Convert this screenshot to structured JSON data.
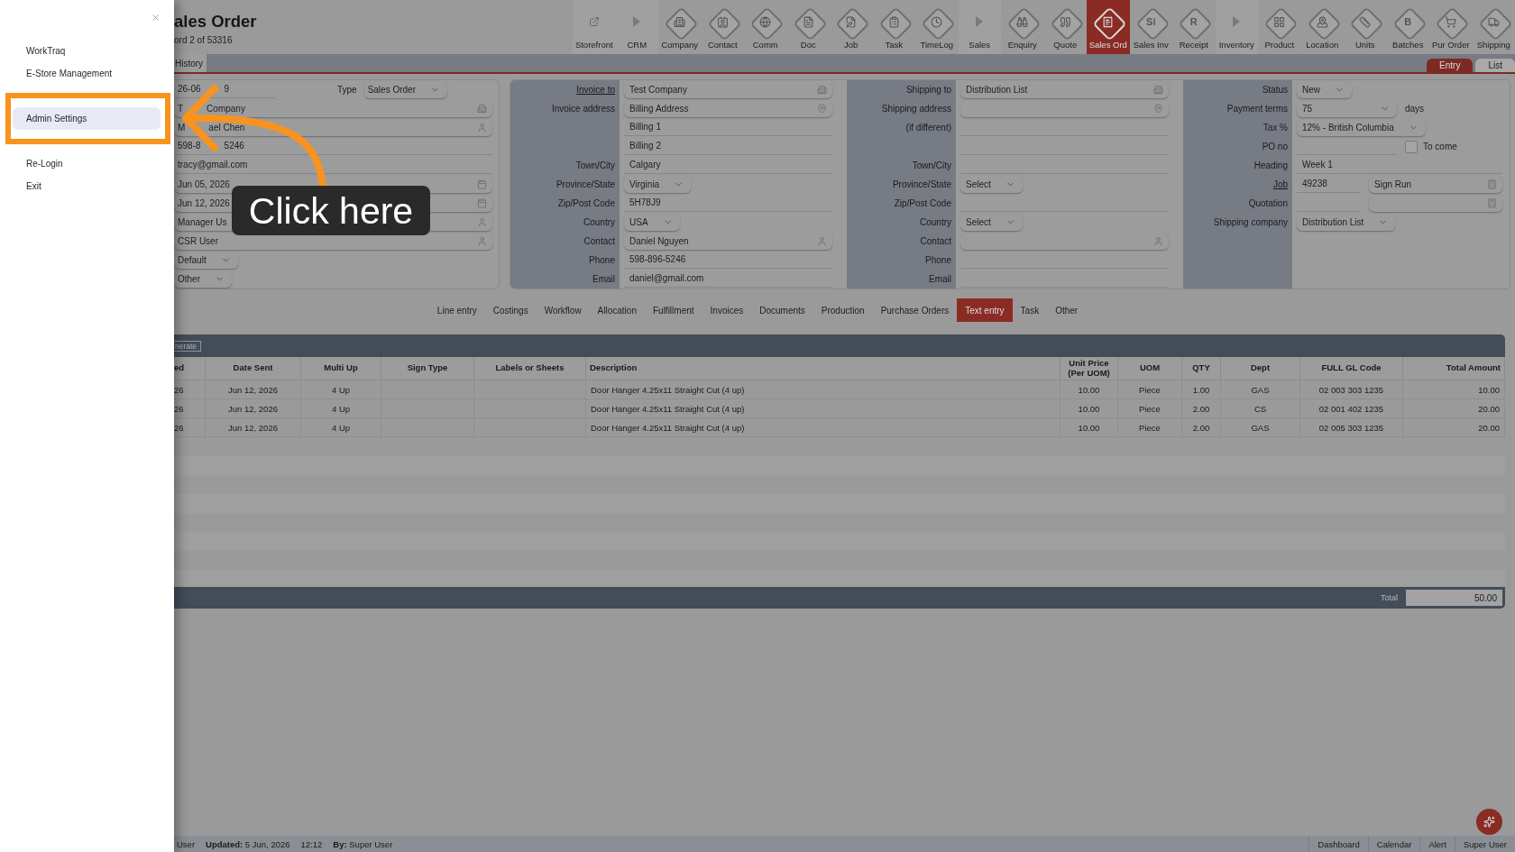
{
  "sidebar": {
    "items": [
      {
        "label": "WorkTraq",
        "selected": false
      },
      {
        "label": "E-Store Management",
        "selected": false
      },
      {
        "label": "Admin Settings",
        "selected": true
      },
      {
        "label": "Re-Login",
        "selected": false
      },
      {
        "label": "Exit",
        "selected": false
      }
    ]
  },
  "tutorial": {
    "callout": "Click here"
  },
  "header": {
    "title": "ales Order",
    "record": "ord 2 of 53316"
  },
  "toolbar": [
    {
      "label": "Storefront",
      "kind": "link",
      "selected": false
    },
    {
      "label": "CRM",
      "kind": "section",
      "selected": false
    },
    {
      "label": "Company",
      "kind": "module",
      "selected": false
    },
    {
      "label": "Contact",
      "kind": "module",
      "selected": false
    },
    {
      "label": "Comm",
      "kind": "module",
      "selected": false
    },
    {
      "label": "Doc",
      "kind": "module",
      "selected": false
    },
    {
      "label": "Job",
      "kind": "module",
      "selected": false
    },
    {
      "label": "Task",
      "kind": "module",
      "selected": false
    },
    {
      "label": "TimeLog",
      "kind": "module",
      "selected": false
    },
    {
      "label": "Sales",
      "kind": "section",
      "selected": false
    },
    {
      "label": "Enquiry",
      "kind": "module",
      "selected": false
    },
    {
      "label": "Quote",
      "kind": "module",
      "selected": false
    },
    {
      "label": "Sales Ord",
      "kind": "module",
      "selected": true
    },
    {
      "label": "Sales Inv",
      "kind": "module",
      "glyph": "Si",
      "selected": false
    },
    {
      "label": "Receipt",
      "kind": "module",
      "glyph": "R",
      "selected": false
    },
    {
      "label": "Inventory",
      "kind": "section",
      "selected": false
    },
    {
      "label": "Product",
      "kind": "module",
      "selected": false
    },
    {
      "label": "Location",
      "kind": "module",
      "selected": false
    },
    {
      "label": "Units",
      "kind": "module",
      "selected": false
    },
    {
      "label": "Batches",
      "kind": "module",
      "glyph": "B",
      "selected": false
    },
    {
      "label": "Pur Order",
      "kind": "module",
      "selected": false
    },
    {
      "label": "Shipping",
      "kind": "module",
      "selected": false
    }
  ],
  "history_tab": {
    "label": "History"
  },
  "view_switch": [
    {
      "label": "Entry",
      "selected": true
    },
    {
      "label": "List",
      "selected": false
    }
  ],
  "header_card": {
    "rows": [
      {
        "parts": [
          {
            "kind": "text",
            "value": "26-06",
            "value_end": "9"
          },
          {
            "kind": "label",
            "value": "Type"
          },
          {
            "kind": "select",
            "value": "Sales Order"
          }
        ]
      },
      {
        "parts": [
          {
            "kind": "company",
            "value": "T",
            "value_end": "Company"
          }
        ]
      },
      {
        "parts": [
          {
            "kind": "contact",
            "value": "M",
            "value_end": "ael Chen"
          }
        ]
      },
      {
        "parts": [
          {
            "kind": "text",
            "value": "598-8",
            "value_end": "5246"
          }
        ]
      },
      {
        "parts": [
          {
            "kind": "text",
            "value": "tracy@gmail.com"
          }
        ]
      },
      {
        "parts": [
          {
            "kind": "date",
            "value": "Jun 05, 2026"
          }
        ]
      },
      {
        "parts": [
          {
            "kind": "date",
            "value": "Jun 12, 2026"
          }
        ]
      },
      {
        "parts": [
          {
            "kind": "contact",
            "value": "Manager Us"
          }
        ]
      },
      {
        "parts": [
          {
            "kind": "contact",
            "value": "CSR User"
          }
        ]
      },
      {
        "parts": [
          {
            "kind": "select",
            "value": "Default"
          }
        ]
      },
      {
        "parts": [
          {
            "kind": "select",
            "value": "Other"
          }
        ]
      }
    ]
  },
  "address_card": {
    "columns": [
      {
        "rows": [
          {
            "label": "Invoice to",
            "link": true,
            "parts": [
              {
                "kind": "company",
                "value": "Test Company"
              }
            ]
          },
          {
            "label": "Invoice address",
            "link": false,
            "parts": [
              {
                "kind": "address",
                "value": "Billing Address"
              }
            ]
          },
          {
            "parts": [
              {
                "kind": "text",
                "value": "Billing 1"
              }
            ]
          },
          {
            "parts": [
              {
                "kind": "text",
                "value": "Billing 2"
              }
            ]
          },
          {
            "label": "Town/City",
            "link": false,
            "parts": [
              {
                "kind": "text",
                "value": "Calgary"
              }
            ]
          },
          {
            "label": "Province/State",
            "link": false,
            "parts": [
              {
                "kind": "select",
                "value": "Virginia"
              }
            ]
          },
          {
            "label": "Zip/Post Code",
            "link": false,
            "parts": [
              {
                "kind": "text",
                "value": "5H78J9"
              }
            ]
          },
          {
            "label": "Country",
            "link": false,
            "parts": [
              {
                "kind": "select",
                "value": "USA"
              }
            ]
          },
          {
            "label": "Contact",
            "link": false,
            "parts": [
              {
                "kind": "contact",
                "value": "Daniel Nguyen"
              }
            ]
          },
          {
            "label": "Phone",
            "link": false,
            "parts": [
              {
                "kind": "text",
                "value": "598-896-5246"
              }
            ]
          },
          {
            "label": "Email",
            "link": false,
            "parts": [
              {
                "kind": "text",
                "value": "daniel@gmail.com"
              }
            ]
          }
        ]
      },
      {
        "rows": [
          {
            "label": "Shipping to",
            "link": false,
            "parts": [
              {
                "kind": "company",
                "value": "Distribution List"
              }
            ]
          },
          {
            "label": "Shipping address",
            "link": false,
            "parts": [
              {
                "kind": "address"
              }
            ]
          },
          {
            "label": "(if different)",
            "link": false,
            "parts": [
              {
                "kind": "text"
              }
            ]
          },
          {
            "parts": [
              {
                "kind": "text"
              }
            ]
          },
          {
            "label": "Town/City",
            "link": false,
            "parts": [
              {
                "kind": "text"
              }
            ]
          },
          {
            "label": "Province/State",
            "link": false,
            "parts": [
              {
                "kind": "select",
                "value": "Select"
              }
            ]
          },
          {
            "label": "Zip/Post Code",
            "link": false,
            "parts": [
              {
                "kind": "text"
              }
            ]
          },
          {
            "label": "Country",
            "link": false,
            "parts": [
              {
                "kind": "select",
                "value": "Select"
              }
            ]
          },
          {
            "label": "Contact",
            "link": false,
            "parts": [
              {
                "kind": "contact"
              }
            ]
          },
          {
            "label": "Phone",
            "link": false,
            "parts": [
              {
                "kind": "text"
              }
            ]
          },
          {
            "label": "Email",
            "link": false,
            "parts": [
              {
                "kind": "text"
              }
            ]
          }
        ]
      },
      {
        "rows": [
          {
            "label": "Status",
            "link": false,
            "parts": [
              {
                "kind": "select",
                "value": "New"
              }
            ]
          },
          {
            "label": "Payment terms",
            "link": false,
            "parts": [
              {
                "kind": "select",
                "value": "75"
              },
              {
                "kind": "unit",
                "value": "days"
              }
            ]
          },
          {
            "label": "Tax %",
            "link": false,
            "parts": [
              {
                "kind": "select",
                "value": "12% - British Columbia"
              }
            ]
          },
          {
            "label": "PO no",
            "link": false,
            "parts": [
              {
                "kind": "text"
              },
              {
                "kind": "checkbox",
                "value": "To come",
                "checked": false
              }
            ]
          },
          {
            "label": "Heading",
            "link": false,
            "parts": [
              {
                "kind": "text",
                "value": "Week 1"
              }
            ]
          },
          {
            "label": "Job",
            "link": true,
            "parts": [
              {
                "kind": "text",
                "value": "49238"
              },
              {
                "kind": "record",
                "value": "Sign Run"
              }
            ]
          },
          {
            "label": "Quotation",
            "link": false,
            "parts": [
              {
                "kind": "text"
              },
              {
                "kind": "record"
              }
            ]
          },
          {
            "label": "Shipping company",
            "link": false,
            "parts": [
              {
                "kind": "select",
                "value": "Distribution List"
              }
            ]
          }
        ]
      }
    ]
  },
  "tabs": [
    {
      "label": "Line entry",
      "selected": false
    },
    {
      "label": "Costings",
      "selected": false
    },
    {
      "label": "Workflow",
      "selected": false
    },
    {
      "label": "Allocation",
      "selected": false
    },
    {
      "label": "Fulfillment",
      "selected": false
    },
    {
      "label": "Invoices",
      "selected": false
    },
    {
      "label": "Documents",
      "selected": false
    },
    {
      "label": "Production",
      "selected": false
    },
    {
      "label": "Purchase Orders",
      "selected": false
    },
    {
      "label": "Text entry",
      "selected": true
    },
    {
      "label": "Task",
      "selected": false
    },
    {
      "label": "Other",
      "selected": false
    }
  ],
  "table": {
    "action": "nerate",
    "columns": [
      "ed",
      "Date Sent",
      "Multi Up",
      "Sign Type",
      "Labels or Sheets",
      "Description",
      "Unit Price (Per UOM)",
      "UOM",
      "QTY",
      "Dept",
      "FULL GL Code",
      "Total Amount"
    ],
    "rows": [
      {
        "column_1": "26",
        "date_sent": "Jun 12, 2026",
        "multi_up": "4 Up",
        "description": "Door Hanger 4.25x11 Straight Cut (4 up)",
        "unit_price": "10.00",
        "uom": "Piece",
        "qty": "1.00",
        "dept": "GAS",
        "gl_code": "02 003 303 1235",
        "total_amount": "10.00"
      },
      {
        "column_1": "26",
        "date_sent": "Jun 12, 2026",
        "multi_up": "4 Up",
        "description": "Door Hanger 4.25x11 Straight Cut (4 up)",
        "unit_price": "10.00",
        "uom": "Piece",
        "qty": "2.00",
        "dept": "CS",
        "gl_code": "02 001 402 1235",
        "total_amount": "20.00"
      },
      {
        "column_1": "26",
        "date_sent": "Jun 12, 2026",
        "multi_up": "4 Up",
        "description": "Door Hanger 4.25x11 Straight Cut (4 up)",
        "unit_price": "10.00",
        "uom": "Piece",
        "qty": "2.00",
        "dept": "GAS",
        "gl_code": "02 005 303 1235",
        "total_amount": "20.00"
      }
    ],
    "total_label": "Total",
    "total": "50.00"
  },
  "status_bar": {
    "info": [
      "User",
      "**Updated:** 5 Jun, 2026",
      "12:12",
      "**By:** Super User"
    ],
    "links": [
      "Dashboard",
      "Calendar",
      "Alert",
      "Super User"
    ]
  }
}
